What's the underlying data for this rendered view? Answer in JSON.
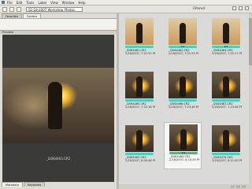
{
  "menubar": {
    "items": [
      "File",
      "Edit",
      "Tools",
      "Label",
      "View",
      "Window",
      "Help"
    ]
  },
  "toolbar": {
    "path": "02-18-2007 Workshop Photos",
    "filter_label": "Filtered"
  },
  "left_panel": {
    "tabs": [
      "Favorites",
      "Folders"
    ],
    "preview_title": "Preview",
    "preview_caption": "_I2064463.CR2",
    "bottom_tabs": [
      "Metadata",
      "Keywords"
    ]
  },
  "thumbnails": [
    {
      "name": "_I2064461.CR2",
      "date": "2/18/2007, 7:21:51 PM",
      "style": "light",
      "label": "teal",
      "stars": ""
    },
    {
      "name": "_I2064462.CR2",
      "date": "2/18/2007, 7:21:53 PM",
      "style": "light",
      "label": "teal",
      "stars": "★★"
    },
    {
      "name": "_I2064464.CR2",
      "date": "2/18/2007, 7:22:17 PM",
      "style": "light",
      "label": "teal",
      "stars": "★★"
    },
    {
      "name": "_I2064465.CR2",
      "date": "2/18/2007, 7:22:18 PM",
      "style": "fire",
      "label": "teal",
      "stars": ""
    },
    {
      "name": "_I2064466.CR2",
      "date": "2/18/2007, 7:23:48 PM",
      "style": "fire",
      "label": "teal",
      "stars": ""
    },
    {
      "name": "_I2064467.CR2",
      "date": "2/18/2007, 7:23:46 PM",
      "style": "fire",
      "label": "teal",
      "stars": ""
    },
    {
      "name": "_I2064463.CR2",
      "date": "2/18/2007, 8:09:46 PM",
      "style": "fire",
      "label": "teal",
      "stars": ""
    },
    {
      "name": "_I2064469.CR2",
      "date": "2/18/2007, 8:10:29 PM",
      "style": "fire",
      "label": "green",
      "stars": "★★"
    },
    {
      "name": "_I2064470.CR2",
      "date": "2/18/2007, 8:11:00 PM",
      "style": "fire",
      "label": "teal",
      "stars": ""
    }
  ],
  "colors": {
    "label_teal": "#3fd3c7",
    "label_green": "#37c46a",
    "content_bg": "#dadad8",
    "chrome_bg": "#e6e4de"
  }
}
